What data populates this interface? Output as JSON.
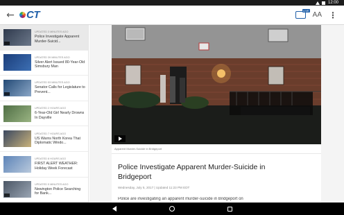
{
  "status_bar": {
    "time": "12:00"
  },
  "app_bar": {
    "logo_text": "CT",
    "tv_badge": "LIVE",
    "font_size_label": "AA",
    "icons": [
      "back-arrow-icon",
      "nbc-peacock-logo",
      "live-tv-icon",
      "text-size-icon",
      "more-vert-icon"
    ],
    "brand_color": "#1e5ea8"
  },
  "sidebar": {
    "stories": [
      {
        "time": "UPDATED 3 MINUTES AGO",
        "headline": "Police Investigate Apparent Murder-Suicid...",
        "selected": true,
        "has_video": true,
        "thumb_colors": [
          "#2f3a4d",
          "#6b7789"
        ]
      },
      {
        "time": "UPDATED 39 MINUTES AGO",
        "headline": "Silver Alert Issued 80-Year-Old Simsbury Man",
        "selected": false,
        "has_video": false,
        "thumb_colors": [
          "#1a3d7a",
          "#3d6fb3"
        ]
      },
      {
        "time": "UPDATED 53 MINUTES AGO",
        "headline": "Senator Calls for Legislature to Prevent...",
        "selected": false,
        "has_video": true,
        "thumb_colors": [
          "#234a76",
          "#8aa6c6"
        ]
      },
      {
        "time": "UPDATED 2 HOURS AGO",
        "headline": "6-Year-Old Girl Nearly Drowns In Dayville",
        "selected": false,
        "has_video": false,
        "thumb_colors": [
          "#4f6e44",
          "#9ab483"
        ]
      },
      {
        "time": "UPDATED 7 HOURS AGO",
        "headline": "US Warns North Korea That Diplomatic Windo...",
        "selected": false,
        "has_video": false,
        "thumb_colors": [
          "#3a4860",
          "#c9b27b"
        ]
      },
      {
        "time": "UPDATED 8 HOURS AGO",
        "headline": "FIRST ALERT WEATHER: Holiday Week Forecast",
        "selected": false,
        "has_video": false,
        "thumb_colors": [
          "#5d84b8",
          "#b9c9dc"
        ]
      },
      {
        "time": "UPDATED 5 MINUTES AGO",
        "headline": "Newington Police Searching for Bank...",
        "selected": false,
        "has_video": true,
        "thumb_colors": [
          "#4b5665",
          "#9aa5b3"
        ]
      }
    ]
  },
  "article": {
    "image_caption": "Apparent Murder-Suicide in Bridgeport",
    "title": "Police Investigate Apparent Murder-Suicide in Bridgeport",
    "meta": "Wednesday, July 5, 2017 | Updated 11:23 PM EDT",
    "body_start": "Police are investigating an apparent murder-suicide in Bridgeport on"
  }
}
